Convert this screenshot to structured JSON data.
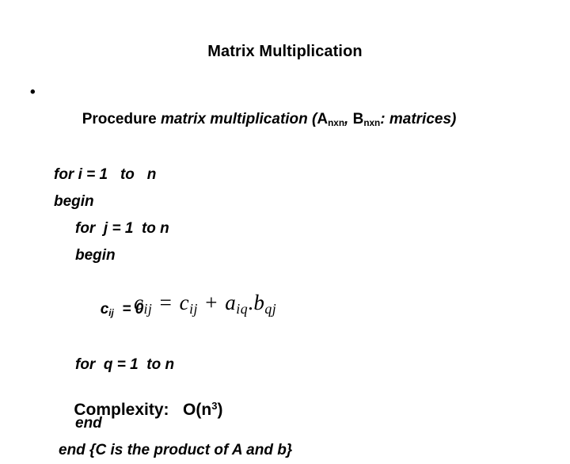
{
  "slide": {
    "title": "Matrix Multiplication",
    "bullet_glyph": "•",
    "procedure": {
      "keyword": "Procedure ",
      "name": "matrix multiplication ",
      "open_paren": "(",
      "param_a": "A",
      "param_a_sub": "nxn",
      "separator": ", ",
      "param_b": "B",
      "param_b_sub": "nxn",
      "type_annotation": ": matrices)"
    },
    "code_lines": [
      {
        "id": "for-i",
        "text": "for i = 1   to   n",
        "indent": "ind-1"
      },
      {
        "id": "begin-outer",
        "text": "begin",
        "indent": "ind-1"
      },
      {
        "id": "for-j",
        "text": "for  j = 1  to n",
        "indent": "ind-2"
      },
      {
        "id": "begin-inner",
        "text": "begin",
        "indent": "ind-2"
      }
    ],
    "assignment": {
      "var": "c",
      "var_sub": "ij",
      "rest": "  = 0"
    },
    "for_q": "for  q = 1  to n",
    "equation": {
      "lhs_var": "c",
      "lhs_sub": "ij",
      "equals": " = ",
      "rhs_var1": "c",
      "rhs_sub1": "ij",
      "plus": " + ",
      "rhs_var2": "a",
      "rhs_sub2": "iq",
      "dot": ".",
      "rhs_var3": "b",
      "rhs_sub3": "qj"
    },
    "end_inner": "end",
    "end_outer": "end {C is the product of A and b}",
    "complexity": {
      "label": "Complexity:",
      "spacer": "   ",
      "value_prefix": "O(n",
      "value_exponent": "3",
      "value_suffix": ")"
    }
  }
}
